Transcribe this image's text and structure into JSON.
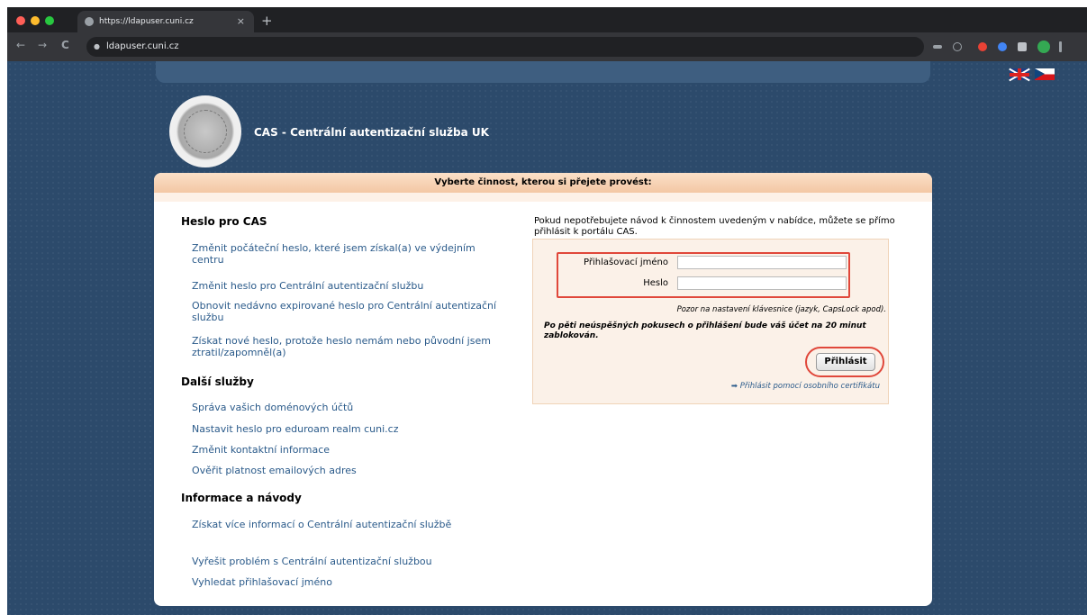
{
  "browser": {
    "tab_title": "https://ldapuser.cuni.cz",
    "tab_close": "×",
    "new_tab": "+",
    "url": "ldapuser.cuni.cz",
    "nav": {
      "back": "←",
      "forward": "→",
      "reload": "C"
    }
  },
  "header": {
    "title": "CAS - Centrální autentizační služba UK"
  },
  "panel": {
    "heading": "Vyberte činnost, kterou si přejete provést:"
  },
  "sections": {
    "heslo": {
      "title": "Heslo pro CAS",
      "links": [
        "Změnit počáteční heslo, které jsem získal(a) ve výdejním centru",
        "Změnit heslo pro Centrální autentizační službu",
        "Obnovit nedávno expirované heslo pro Centrální autentizační službu",
        "Získat nové heslo, protože heslo nemám nebo původní jsem ztratil/zapomněl(a)"
      ]
    },
    "dalsi": {
      "title": "Další služby",
      "links": [
        "Správa vašich doménových účtů",
        "Nastavit heslo pro eduroam realm cuni.cz",
        "Změnit kontaktní informace",
        "Ověřit platnost emailových adres"
      ]
    },
    "info": {
      "title": "Informace a návody",
      "links": [
        "Získat více informací o Centrální autentizační službě",
        "Vyřešit problém s Centrální autentizační službou",
        "Vyhledat přihlašovací jméno"
      ]
    }
  },
  "login": {
    "intro": "Pokud nepotřebujete návod k činnostem uvedeným v nabídce, můžete se přímo přihlásit k portálu CAS.",
    "username_label": "Přihlašovací jméno",
    "username_value": "",
    "password_label": "Heslo",
    "password_value": "",
    "keyboard_warning": "Pozor na nastavení klávesnice (jazyk, CapsLock apod).",
    "lock_warning": "Po pěti neúspěšných pokusech o přihlášení bude váš účet na 20 minut zablokován.",
    "submit_label": "Přihlásit",
    "cert_link": "➡ Přihlásit pomocí osobního certifikátu"
  },
  "colors": {
    "page_bg": "#2c4a6b",
    "link": "#2a5a8a",
    "highlight": "#e0473a"
  }
}
